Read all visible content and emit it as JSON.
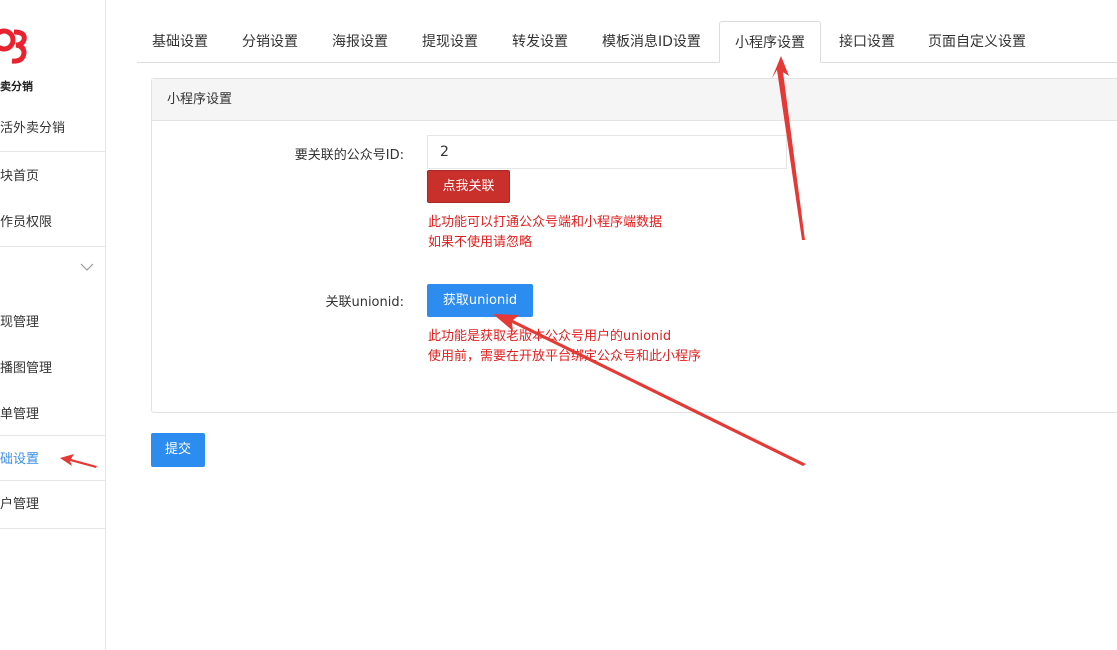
{
  "sidebar": {
    "logo_text": "卖分销",
    "items": [
      {
        "label": "活外卖分销"
      },
      {
        "label": "块首页"
      },
      {
        "label": "作员权限"
      },
      {
        "label": "现管理"
      },
      {
        "label": "播图管理"
      },
      {
        "label": "单管理"
      },
      {
        "label": "础设置",
        "active": true
      },
      {
        "label": "户管理"
      }
    ]
  },
  "tabs": [
    {
      "label": "基础设置"
    },
    {
      "label": "分销设置"
    },
    {
      "label": "海报设置"
    },
    {
      "label": "提现设置"
    },
    {
      "label": "转发设置"
    },
    {
      "label": "模板消息ID设置"
    },
    {
      "label": "小程序设置",
      "active": true
    },
    {
      "label": "接口设置"
    },
    {
      "label": "页面自定义设置"
    }
  ],
  "panel": {
    "title": "小程序设置",
    "account_id_label": "要关联的公众号ID:",
    "account_id_value": "2",
    "link_button": "点我关联",
    "link_note_1": "此功能可以打通公众号端和小程序端数据",
    "link_note_2": "如果不使用请忽略",
    "unionid_label": "关联unionid:",
    "unionid_button": "获取unionid",
    "unionid_note_1": "此功能是获取老版本公众号用户的unionid",
    "unionid_note_2": "使用前，需要在开放平台绑定公众号和此小程序"
  },
  "submit_label": "提交",
  "colors": {
    "accent_blue": "#2d8cf0",
    "danger_red": "#c9302c",
    "note_red": "#e02020",
    "annotation_arrow": "#e53935"
  }
}
